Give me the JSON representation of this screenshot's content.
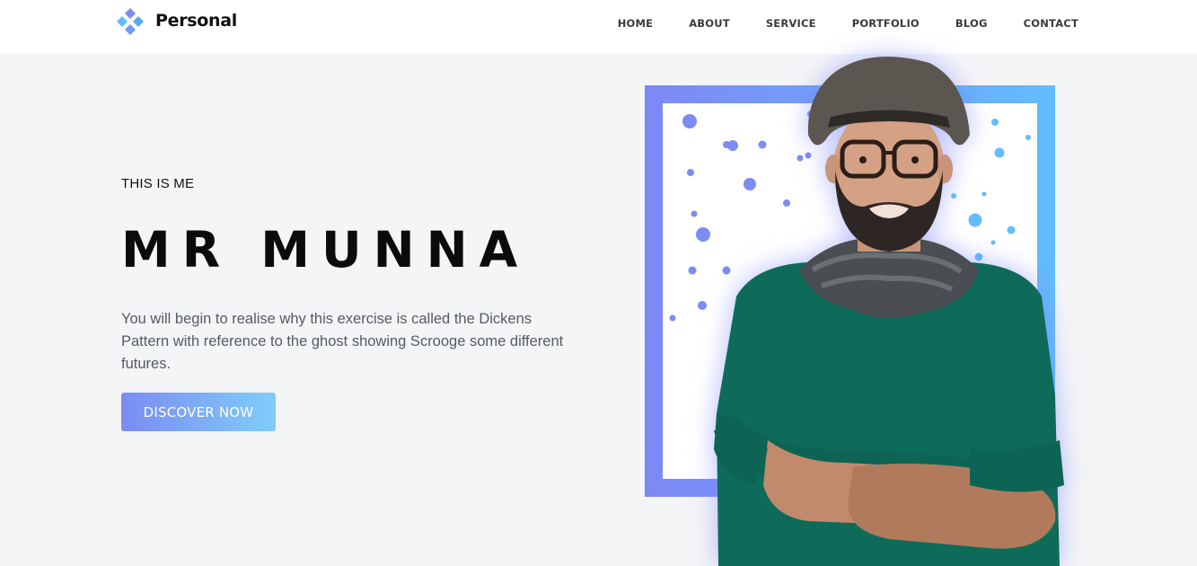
{
  "brand": {
    "name": "Personal",
    "logo_icon": "diamond-cluster-logo-icon",
    "colors": {
      "primary": "#7b8cf2",
      "secondary": "#63bdfc"
    }
  },
  "nav": {
    "items": [
      {
        "label": "HOME"
      },
      {
        "label": "ABOUT"
      },
      {
        "label": "SERVICE"
      },
      {
        "label": "PORTFOLIO"
      },
      {
        "label": "BLOG"
      },
      {
        "label": "CONTACT"
      }
    ]
  },
  "hero": {
    "kicker": "THIS IS ME",
    "name": "MR MUNNA",
    "description": "You will begin to realise why this exercise is called the Dickens Pattern with reference to the ghost showing Scrooge some different futures.",
    "cta_label": "DISCOVER NOW",
    "image_icon": "portrait-illustration-icon"
  }
}
